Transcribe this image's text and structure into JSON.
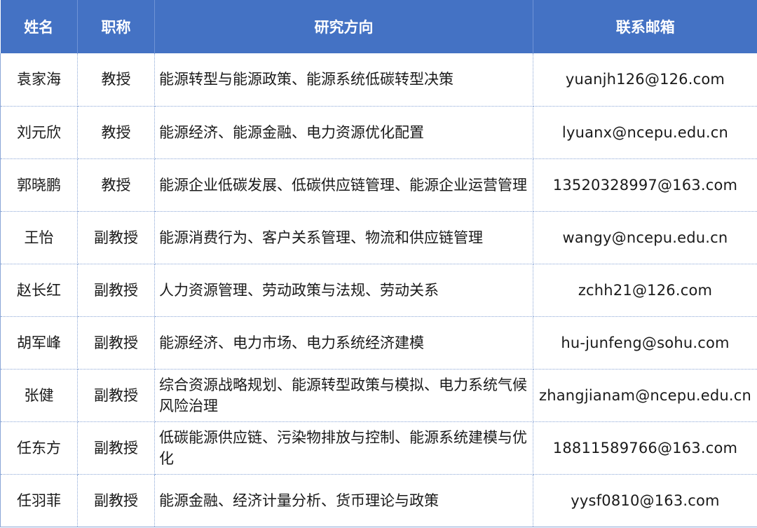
{
  "header": {
    "name": "姓名",
    "title": "职称",
    "research": "研究方向",
    "email": "联系邮箱"
  },
  "rows": [
    {
      "name": "袁家海",
      "title": "教授",
      "research": "能源转型与能源政策、能源系统低碳转型决策",
      "email": "yuanjh126@126.com"
    },
    {
      "name": "刘元欣",
      "title": "教授",
      "research": "能源经济、能源金融、电力资源优化配置",
      "email": "lyuanx@ncepu.edu.cn"
    },
    {
      "name": "郭晓鹏",
      "title": "教授",
      "research": "能源企业低碳发展、低碳供应链管理、能源企业运营管理",
      "email": "13520328997@163.com"
    },
    {
      "name": "王怡",
      "title": "副教授",
      "research": "能源消费行为、客户关系管理、物流和供应链管理",
      "email": "wangy@ncepu.edu.cn"
    },
    {
      "name": "赵长红",
      "title": "副教授",
      "research": "人力资源管理、劳动政策与法规、劳动关系",
      "email": "zchh21@126.com"
    },
    {
      "name": "胡军峰",
      "title": "副教授",
      "research": "能源经济、电力市场、电力系统经济建模",
      "email": "hu-junfeng@sohu.com"
    },
    {
      "name": "张健",
      "title": "副教授",
      "research": "综合资源战略规划、能源转型政策与模拟、电力系统气候风险治理",
      "email": "zhangjianam@ncepu.edu.cn"
    },
    {
      "name": "任东方",
      "title": "副教授",
      "research": "低碳能源供应链、污染物排放与控制、能源系统建模与优化",
      "email": "18811589766@163.com"
    },
    {
      "name": "任羽菲",
      "title": "副教授",
      "research": "能源金融、经济计量分析、货币理论与政策",
      "email": "yysf0810@163.com"
    }
  ]
}
